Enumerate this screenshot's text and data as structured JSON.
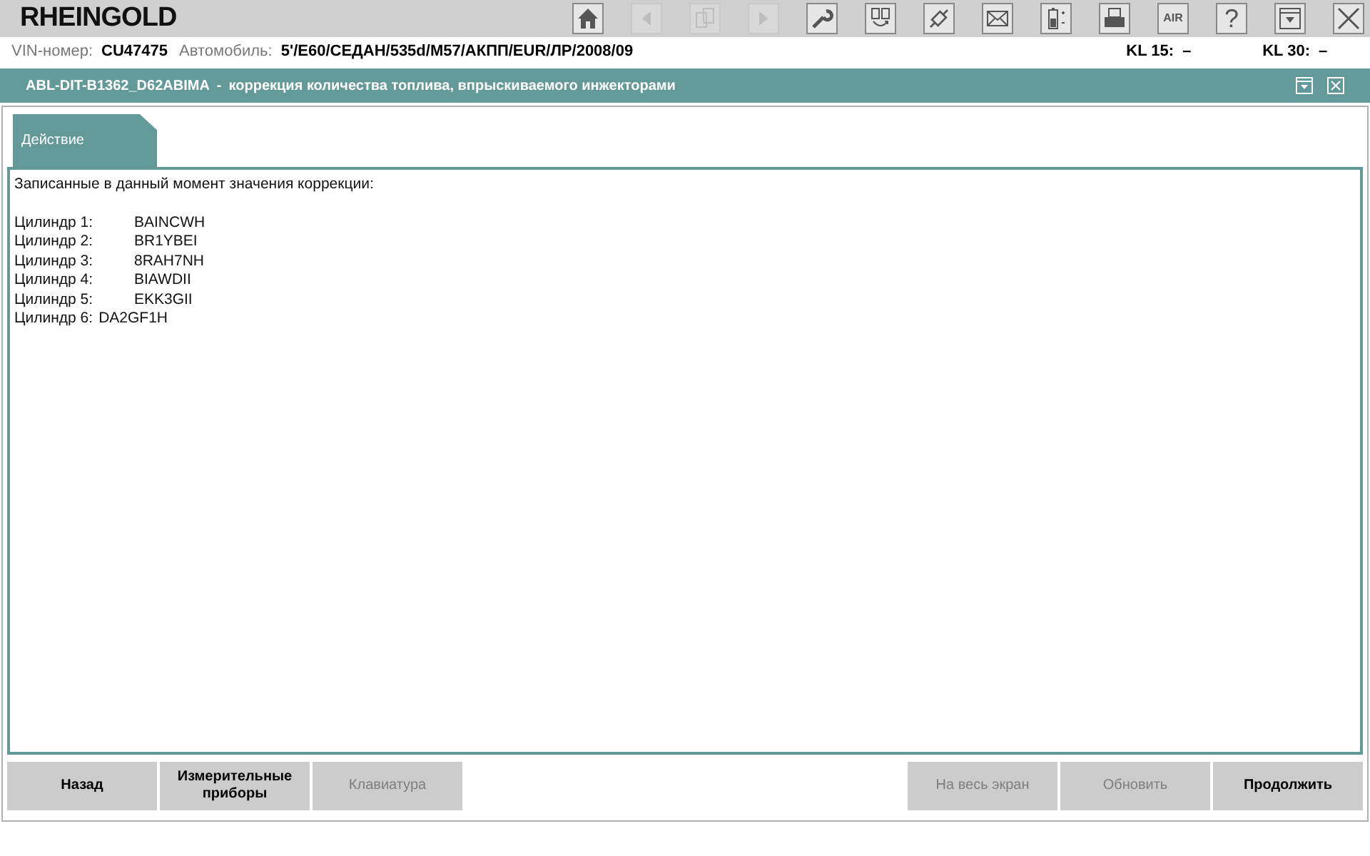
{
  "app": {
    "title": "RHEINGOLD"
  },
  "toolbar": [
    {
      "kind": "home",
      "disabled": false
    },
    {
      "kind": "back",
      "disabled": true
    },
    {
      "kind": "copy",
      "disabled": true
    },
    {
      "kind": "forward",
      "disabled": true
    },
    {
      "kind": "wrench",
      "disabled": false
    },
    {
      "kind": "swap",
      "disabled": false
    },
    {
      "kind": "plug",
      "disabled": false
    },
    {
      "kind": "mail",
      "disabled": false
    },
    {
      "kind": "battery",
      "disabled": false
    },
    {
      "kind": "printer",
      "disabled": false
    },
    {
      "kind": "air",
      "label": "AIR",
      "disabled": false
    },
    {
      "kind": "help",
      "label": "?",
      "disabled": false
    },
    {
      "kind": "panel",
      "disabled": false
    },
    {
      "kind": "close",
      "disabled": false
    }
  ],
  "vehicle": {
    "vin_label": "VIN-номер:",
    "vin": "CU47475",
    "car_label": "Автомобиль:",
    "car": "5'/E60/СЕДАН/535d/M57/АКПП/EUR/ЛР/2008/09",
    "kl15_label": "KL 15:",
    "kl15": "–",
    "kl30_label": "KL 30:",
    "kl30": "–"
  },
  "title_bar": {
    "code": "ABL-DIT-B1362_D62ABIMA",
    "separator": "-",
    "title": "коррекция количества топлива, впрыскиваемого инжекторами"
  },
  "tabs": [
    {
      "label": "Действие",
      "selected": true
    }
  ],
  "content": {
    "heading": "Записанные в данный момент значения коррекции:",
    "rows": [
      {
        "label": "Цилиндр 1:",
        "value": "BAINCWH",
        "aligned": true
      },
      {
        "label": "Цилиндр 2:",
        "value": "BR1YBEI",
        "aligned": true
      },
      {
        "label": "Цилиндр 3:",
        "value": "8RAH7NH",
        "aligned": true
      },
      {
        "label": "Цилиндр 4:",
        "value": "BIAWDII",
        "aligned": true
      },
      {
        "label": "Цилиндр 5:",
        "value": "EKK3GII",
        "aligned": true
      },
      {
        "label": "Цилиндр 6:",
        "value": "DA2GF1H",
        "aligned": false
      }
    ]
  },
  "buttons_left": [
    {
      "label": "Назад",
      "disabled": false
    },
    {
      "label": "Измерительные приборы",
      "disabled": false
    },
    {
      "label": "Клавиатура",
      "disabled": true
    }
  ],
  "buttons_right": [
    {
      "label": "На весь экран",
      "disabled": true
    },
    {
      "label": "Обновить",
      "disabled": true
    },
    {
      "label": "Продолжить",
      "disabled": false
    }
  ]
}
